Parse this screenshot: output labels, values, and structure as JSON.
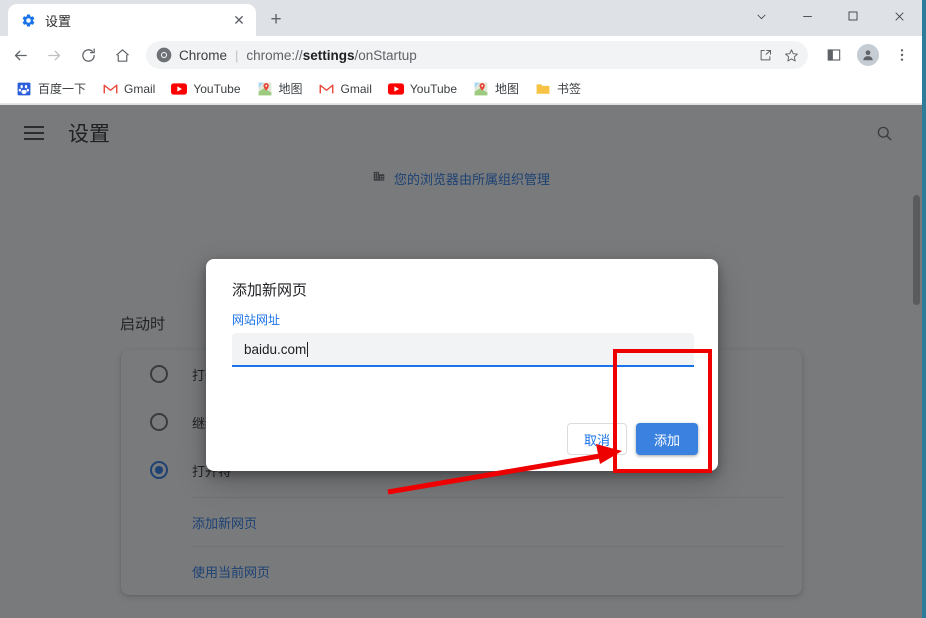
{
  "window": {
    "controls": [
      {
        "name": "tab-search",
        "glyph": "⌄"
      },
      {
        "name": "minimize",
        "glyph": "—"
      },
      {
        "name": "maximize",
        "glyph": "□"
      },
      {
        "name": "close",
        "glyph": "✕"
      }
    ]
  },
  "tab": {
    "title": "设置",
    "favicon": "gear-icon",
    "close_glyph": "✕",
    "newtab_glyph": "+"
  },
  "toolbar": {
    "back_glyph": "←",
    "forward_glyph": "→",
    "reload_glyph": "↻",
    "home_glyph": "⌂",
    "omnibox": {
      "chip_label": "Chrome",
      "separator": "|",
      "url_prefix": "chrome://",
      "url_bold": "settings",
      "url_suffix": "/onStartup",
      "full_url": "chrome://settings/onStartup",
      "share_glyph": "⤴",
      "star_glyph": "☆"
    },
    "side_panel_glyph": "▣",
    "menu_glyph": "⋮"
  },
  "bookmarks": [
    {
      "label": "百度一下",
      "icon": "baidu-paw-icon",
      "color": "#2b5fd9"
    },
    {
      "label": "Gmail",
      "icon": "gmail-icon",
      "color": "#ea4335"
    },
    {
      "label": "YouTube",
      "icon": "youtube-icon",
      "color": "#ff0000"
    },
    {
      "label": "地图",
      "icon": "maps-pin-icon",
      "color": "#34a853"
    },
    {
      "label": "Gmail",
      "icon": "gmail-icon",
      "color": "#ea4335"
    },
    {
      "label": "YouTube",
      "icon": "youtube-icon",
      "color": "#ff0000"
    },
    {
      "label": "地图",
      "icon": "maps-pin-icon",
      "color": "#34a853"
    },
    {
      "label": "书签",
      "icon": "folder-icon",
      "color": "#f6c344"
    }
  ],
  "settings": {
    "menu_icon": "hamburger-icon",
    "title": "设置",
    "search_icon": "search-icon",
    "managed_banner": {
      "icon": "building-icon",
      "text": "您的浏览器由所属组织管理"
    },
    "section_title": "启动时",
    "options": [
      {
        "label": "打开新",
        "checked": false
      },
      {
        "label": "继续浏",
        "checked": false
      },
      {
        "label": "打开特",
        "checked": true
      }
    ],
    "links": [
      {
        "label": "添加新网页"
      },
      {
        "label": "使用当前网页"
      }
    ]
  },
  "dialog": {
    "title": "添加新网页",
    "field_label": "网站网址",
    "input_value": "baidu.com",
    "input_placeholder": "",
    "cancel_label": "取消",
    "add_label": "添加"
  },
  "annotation": {
    "rect_color": "#ee0000",
    "arrow_color": "#ee0000"
  },
  "colors": {
    "accent": "#1a73e8",
    "button_blue": "#3b82e0",
    "frame": "#dee1e6",
    "overlay": "rgba(32,33,36,.60)",
    "desktop": "#2d7d9a"
  }
}
